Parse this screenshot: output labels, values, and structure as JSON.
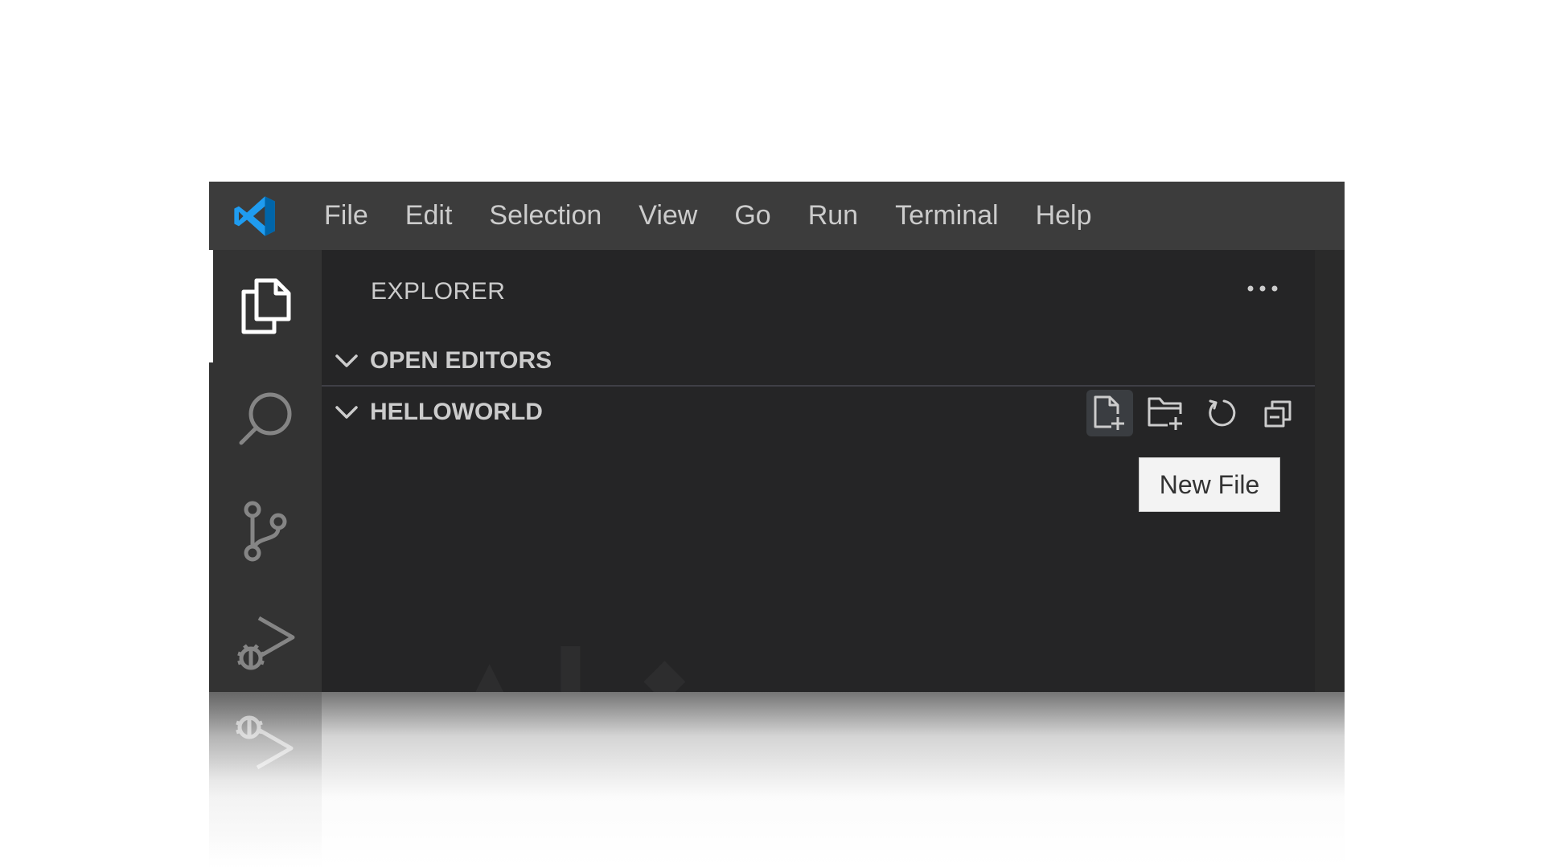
{
  "menu": {
    "items": [
      "File",
      "Edit",
      "Selection",
      "View",
      "Go",
      "Run",
      "Terminal",
      "Help"
    ]
  },
  "sidebar": {
    "title": "EXPLORER",
    "sections": {
      "open_editors": "OPEN EDITORS",
      "folder": "HELLOWORLD"
    }
  },
  "tooltip": {
    "text": "New File"
  },
  "icons": {
    "logo": "vscode-logo-icon",
    "activity": [
      "explorer-icon",
      "search-icon",
      "source-control-icon",
      "run-debug-icon"
    ],
    "folder_actions": [
      "new-file-icon",
      "new-folder-icon",
      "refresh-icon",
      "collapse-all-icon"
    ],
    "more": "more-actions-icon",
    "chevron": "chevron-down-icon"
  },
  "colors": {
    "titlebar": "#3c3c3c",
    "activitybar": "#333333",
    "sidebar": "#252526",
    "accent": "#007acc",
    "text": "#cccccc",
    "tooltip_bg": "#f3f3f3"
  }
}
